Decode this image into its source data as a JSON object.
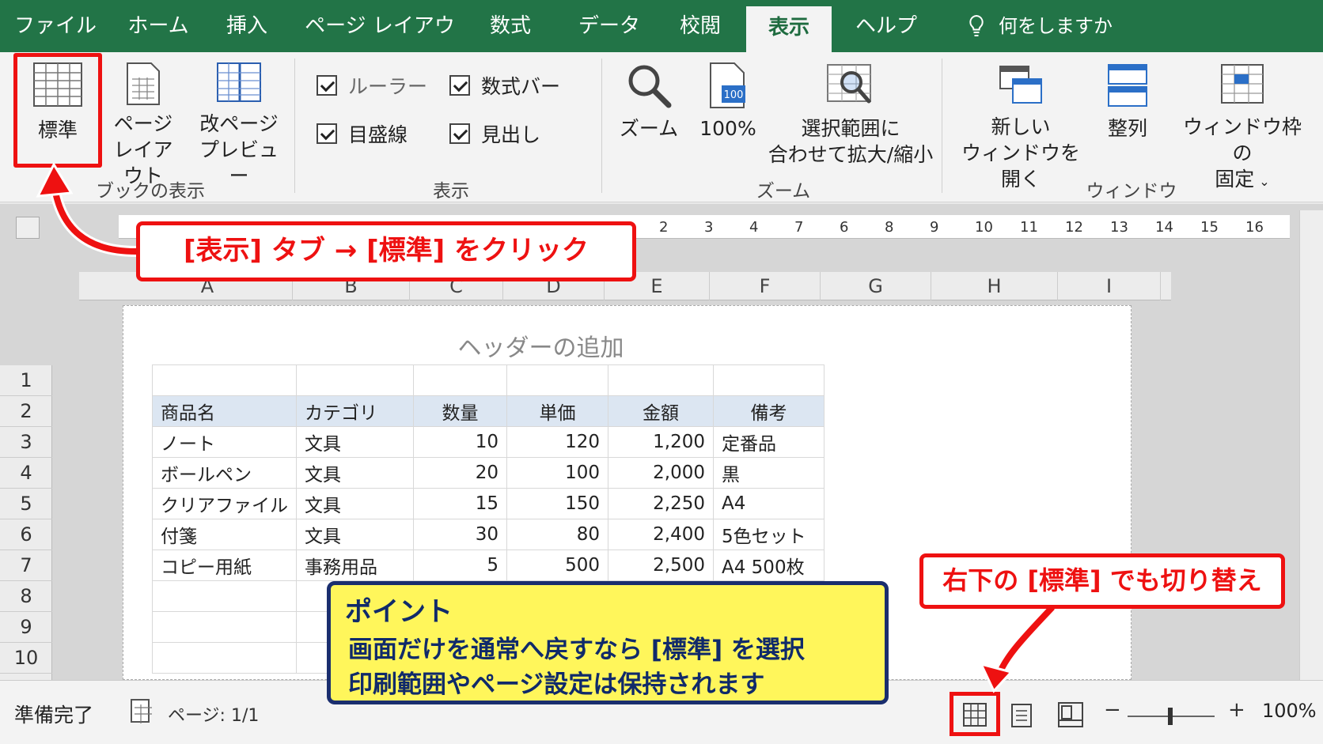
{
  "tabs": [
    "ファイル",
    "ホーム",
    "挿入",
    "ページ レイアウト",
    "数式",
    "データ",
    "校閲",
    "表示",
    "ヘルプ"
  ],
  "tell_me": "何をしますか",
  "ribbon": {
    "workbook_views": {
      "normal": "標準",
      "page_layout_1": "ページ",
      "page_layout_2": "レイアウト",
      "page_break_1": "改ページ",
      "page_break_2": "プレビュー",
      "group": "ブックの表示"
    },
    "show": {
      "ruler": "ルーラー",
      "formula_bar": "数式バー",
      "gridlines": "目盛線",
      "headings": "見出し",
      "group": "表示"
    },
    "zoom": {
      "zoom": "ズーム",
      "zoom100": "100%",
      "sel_1": "選択範囲に",
      "sel_2": "合わせて拡大/縮小",
      "group": "ズーム"
    },
    "window": {
      "new_1": "新しい",
      "new_2": "ウィンドウを開く",
      "arrange": "整列",
      "freeze_1": "ウィンドウ枠の",
      "freeze_2": "固定",
      "group": "ウィンドウ"
    }
  },
  "ruler_ticks": [
    "2",
    "3",
    "4",
    "7",
    "6",
    "8",
    "9",
    "10",
    "11",
    "12",
    "13",
    "14",
    "15",
    "16"
  ],
  "columns": [
    "A",
    "B",
    "C",
    "D",
    "E",
    "F",
    "G",
    "H",
    "I"
  ],
  "rows": [
    "1",
    "2",
    "3",
    "4",
    "5",
    "6",
    "7",
    "8",
    "9",
    "10"
  ],
  "header_placeholder": "ヘッダーの追加",
  "table": {
    "headers": [
      "商品名",
      "カテゴリ",
      "数量",
      "単価",
      "金額",
      "備考"
    ],
    "rows": [
      [
        "ノート",
        "文具",
        "10",
        "120",
        "1,200",
        "定番品"
      ],
      [
        "ボールペン",
        "文具",
        "20",
        "100",
        "2,000",
        "黒"
      ],
      [
        "クリアファイル",
        "文具",
        "15",
        "150",
        "2,250",
        "A4"
      ],
      [
        "付箋",
        "文具",
        "30",
        "80",
        "2,400",
        "5色セット"
      ],
      [
        "コピー用紙",
        "事務用品",
        "5",
        "500",
        "2,500",
        "A4 500枚"
      ]
    ]
  },
  "status": {
    "ready": "準備完了",
    "page": "ページ: 1/1",
    "zoom": "100%",
    "minus": "−",
    "plus": "+"
  },
  "callouts": {
    "main": "[表示] タブ → [標準] をクリック",
    "corner": "右下の [標準] でも切り替え",
    "point_title": "ポイント",
    "point_line1": "画面だけを通常へ戻すなら [標準] を選択",
    "point_line2": "印刷範囲やページ設定は保持されます"
  },
  "colors": {
    "excel_green": "#227447",
    "highlight": "#e11111",
    "point_bg": "#fff65b",
    "point_border": "#1a2e6e"
  }
}
